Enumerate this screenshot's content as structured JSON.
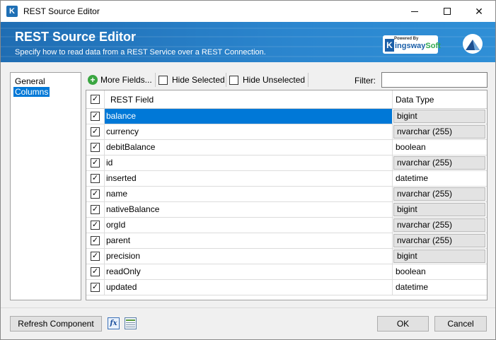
{
  "window": {
    "title": "REST Source Editor",
    "app_icon_letter": "K"
  },
  "banner": {
    "title": "REST Source Editor",
    "subtitle": "Specify how to read data from a REST Service over a REST Connection.",
    "brand_powered": "Powered By",
    "brand_k": "K",
    "brand_name_main": "ingsway",
    "brand_name_soft": "Soft",
    "colors": {
      "banner_start": "#1f6db3",
      "banner_end": "#2f8fd6"
    }
  },
  "nav": {
    "items": [
      {
        "label": "General",
        "selected": false
      },
      {
        "label": "Columns",
        "selected": true
      }
    ]
  },
  "toolbar": {
    "more_fields": "More Fields...",
    "hide_selected": "Hide Selected",
    "hide_unselected": "Hide Unselected",
    "filter_label": "Filter:",
    "filter_value": ""
  },
  "grid": {
    "headers": {
      "field": "REST Field",
      "type": "Data Type"
    },
    "rows": [
      {
        "checked": true,
        "field": "balance",
        "type": "bigint",
        "boxed": true,
        "selected": true
      },
      {
        "checked": true,
        "field": "currency",
        "type": "nvarchar (255)",
        "boxed": true
      },
      {
        "checked": true,
        "field": "debitBalance",
        "type": "boolean",
        "boxed": false
      },
      {
        "checked": true,
        "field": "id",
        "type": "nvarchar (255)",
        "boxed": true
      },
      {
        "checked": true,
        "field": "inserted",
        "type": "datetime",
        "boxed": false
      },
      {
        "checked": true,
        "field": "name",
        "type": "nvarchar (255)",
        "boxed": true
      },
      {
        "checked": true,
        "field": "nativeBalance",
        "type": "bigint",
        "boxed": true
      },
      {
        "checked": true,
        "field": "orgId",
        "type": "nvarchar (255)",
        "boxed": true
      },
      {
        "checked": true,
        "field": "parent",
        "type": "nvarchar (255)",
        "boxed": true
      },
      {
        "checked": true,
        "field": "precision",
        "type": "bigint",
        "boxed": true
      },
      {
        "checked": true,
        "field": "readOnly",
        "type": "boolean",
        "boxed": false
      },
      {
        "checked": true,
        "field": "updated",
        "type": "datetime",
        "boxed": false
      }
    ]
  },
  "footer": {
    "refresh": "Refresh Component",
    "fx_icon_label": "fx",
    "ok": "OK",
    "cancel": "Cancel"
  }
}
